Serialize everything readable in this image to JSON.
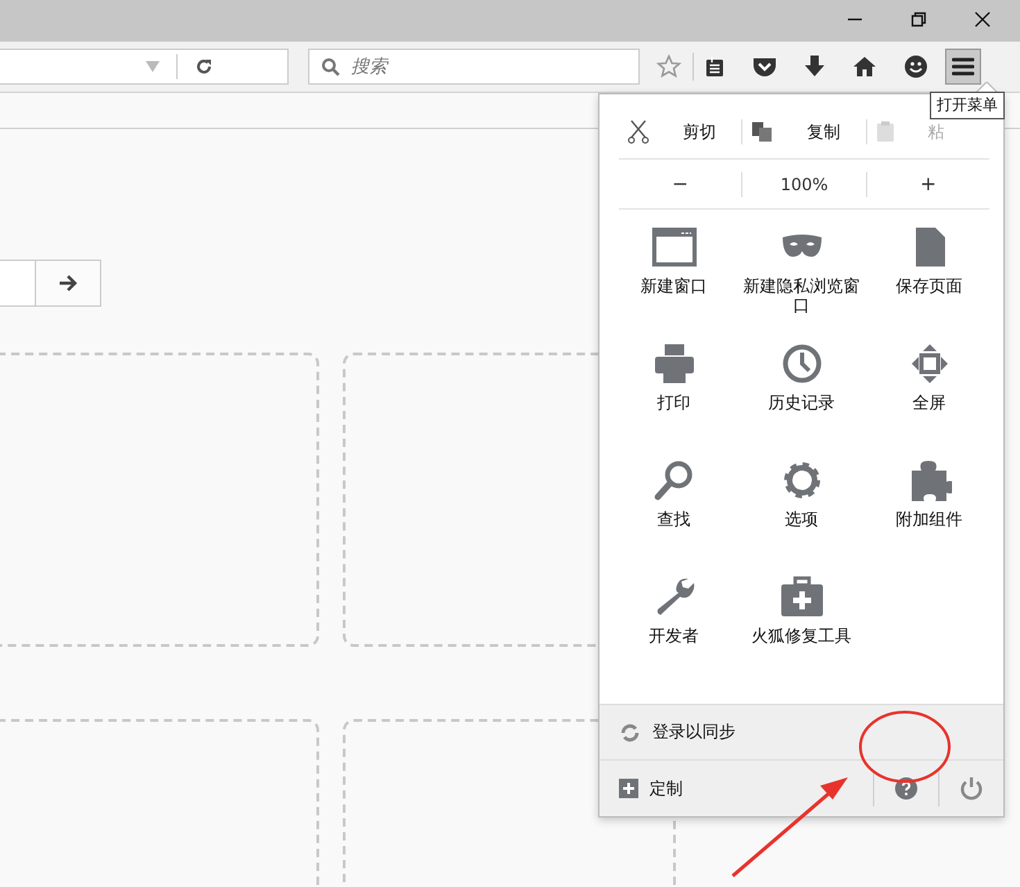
{
  "toolbar": {
    "search": {
      "placeholder": "搜索"
    },
    "menu_button": {
      "pressed": true
    },
    "tooltip": "打开菜单"
  },
  "menu": {
    "edit_row": [
      {
        "kind": "cut",
        "label": "剪切",
        "disabled": false
      },
      {
        "kind": "copy",
        "label": "复制",
        "disabled": false
      },
      {
        "kind": "paste",
        "label": "粘",
        "disabled": true
      }
    ],
    "zoom": {
      "out": "−",
      "level": "100%",
      "in": "+"
    },
    "items": [
      {
        "kind": "window",
        "label": "新建窗口"
      },
      {
        "kind": "private",
        "label": "新建隐私浏览窗口"
      },
      {
        "kind": "save",
        "label": "保存页面"
      },
      {
        "kind": "print",
        "label": "打印"
      },
      {
        "kind": "history",
        "label": "历史记录"
      },
      {
        "kind": "fullscreen",
        "label": "全屏"
      },
      {
        "kind": "find",
        "label": "查找"
      },
      {
        "kind": "options",
        "label": "选项"
      },
      {
        "kind": "addons",
        "label": "附加组件"
      },
      {
        "kind": "developer",
        "label": "开发者"
      },
      {
        "kind": "repair",
        "label": "火狐修复工具"
      }
    ],
    "sync": "登录以同步",
    "customize": "定制"
  }
}
